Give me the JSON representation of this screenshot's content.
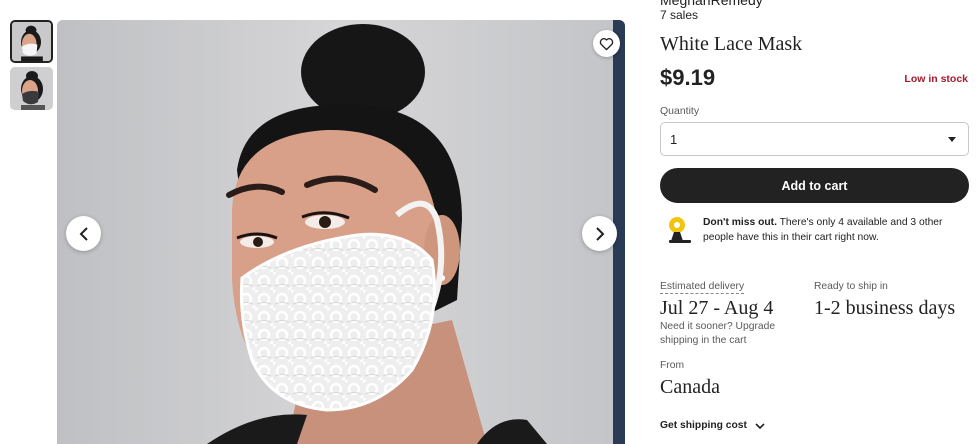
{
  "shop": {
    "name": "MeghanRemedy",
    "sales": "7 sales"
  },
  "product": {
    "title": "White Lace Mask",
    "price": "$9.19",
    "stock_status": "Low in stock"
  },
  "quantity": {
    "label": "Quantity",
    "selected": "1"
  },
  "cart_button": "Add to cart",
  "scarcity": {
    "bold": "Don't miss out.",
    "text": " There's only 4 available and 3 other people have this in their cart right now."
  },
  "delivery": {
    "estimated_label": "Estimated delivery",
    "estimated_dates": "Jul 27 - Aug 4",
    "sooner_text": "Need it sooner? Upgrade shipping in the cart",
    "ready_label": "Ready to ship in",
    "ready_value": "1-2 business days",
    "from_label": "From",
    "from_value": "Canada",
    "shipping_cost_link": "Get shipping cost"
  },
  "colors": {
    "text": "#222222",
    "muted": "#595959",
    "stock_alert": "#a61a2e",
    "button_bg": "#222222",
    "image_bg": "#c9c9cb"
  },
  "icons": [
    "heart-icon",
    "chevron-left-icon",
    "chevron-right-icon",
    "alarm-bell-icon",
    "chevron-down-icon",
    "dropdown-caret-icon"
  ]
}
